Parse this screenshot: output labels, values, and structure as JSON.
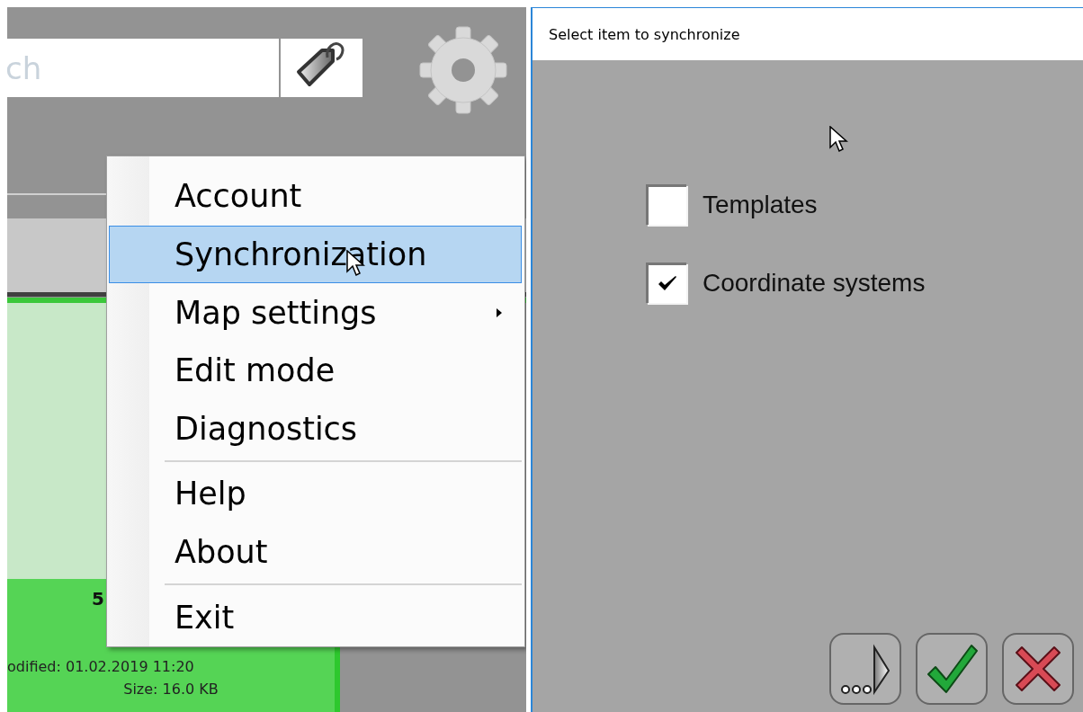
{
  "main_window": {
    "search": {
      "placeholder": "ch"
    },
    "file_card": {
      "title": "5",
      "modified": "odified: 01.02.2019 11:20",
      "size": "Size: 16.0 KB"
    }
  },
  "menu": {
    "items": [
      {
        "kind": "item",
        "label": "Account",
        "selected": false
      },
      {
        "kind": "item",
        "label": "Synchronization",
        "selected": true
      },
      {
        "kind": "submenu",
        "label": "Map settings",
        "selected": false
      },
      {
        "kind": "item",
        "label": "Edit mode",
        "selected": false
      },
      {
        "kind": "item",
        "label": "Diagnostics",
        "selected": false
      },
      {
        "kind": "separator"
      },
      {
        "kind": "item",
        "label": "Help",
        "selected": false
      },
      {
        "kind": "item",
        "label": "About",
        "selected": false
      },
      {
        "kind": "separator"
      },
      {
        "kind": "item",
        "label": "Exit",
        "selected": false
      }
    ]
  },
  "dialog": {
    "title": "Select item to synchronize",
    "options": [
      {
        "label": "Templates",
        "checked": false
      },
      {
        "label": "Coordinate systems",
        "checked": true
      }
    ]
  }
}
